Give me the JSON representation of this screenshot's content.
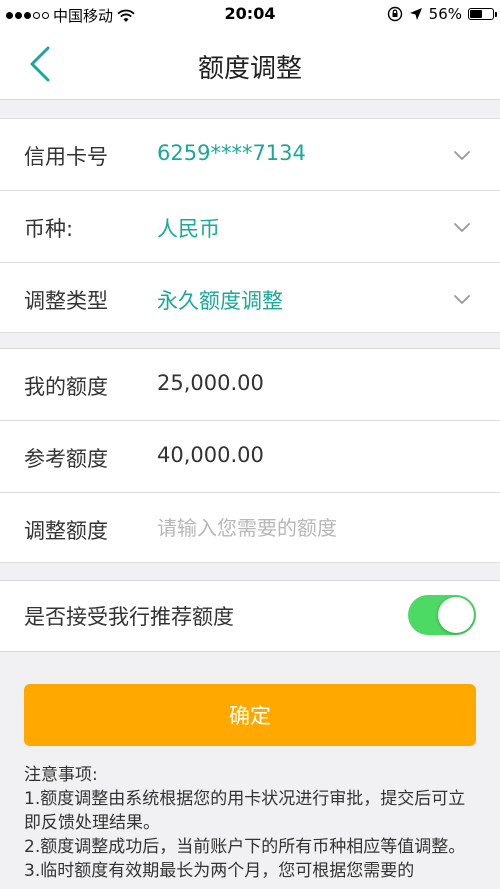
{
  "status_bar": {
    "carrier": "中国移动",
    "time": "20:04",
    "battery": "56%",
    "battery_level": 0.56
  },
  "nav": {
    "title": "额度调整"
  },
  "card_group": {
    "card_number_label": "信用卡号",
    "card_number_value": "6259****7134",
    "currency_label": "币种:",
    "currency_value": "人民币",
    "adjust_type_label": "调整类型",
    "adjust_type_value": "永久额度调整"
  },
  "limit_group": {
    "my_limit_label": "我的额度",
    "my_limit_value": "25,000.00",
    "reference_limit_label": "参考额度",
    "reference_limit_value": "40,000.00",
    "adjust_amount_label": "调整额度",
    "adjust_amount_placeholder": "请输入您需要的额度",
    "adjust_amount_value": ""
  },
  "recommend": {
    "label": "是否接受我行推荐额度",
    "enabled": true
  },
  "confirm_label": "确定",
  "notes": {
    "heading": "注意事项:",
    "items": [
      "1.额度调整由系统根据您的用卡状况进行审批，提交后可立即反馈处理结果。",
      "2.额度调整成功后，当前账户下的所有币种相应等值调整。",
      "3.临时额度有效期最长为两个月，您可根据您需要的"
    ]
  },
  "colors": {
    "accent": "#1aa898",
    "confirm": "#ffa800",
    "toggle_on": "#4cd964",
    "background": "#f1f1f3"
  }
}
